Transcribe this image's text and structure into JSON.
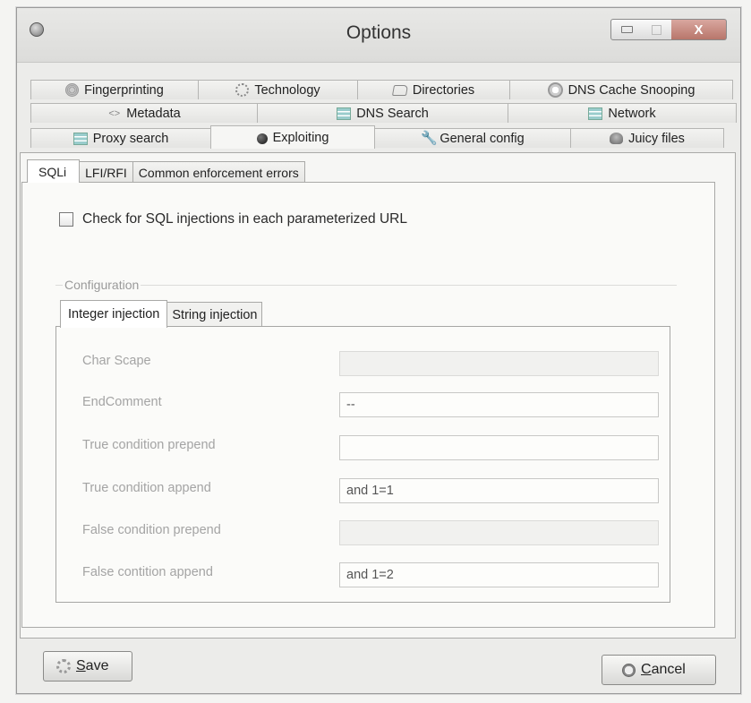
{
  "window": {
    "title": "Options",
    "close_glyph": "X"
  },
  "tabs": {
    "row1": [
      {
        "label": "Fingerprinting",
        "icon": "fingerprint-icon"
      },
      {
        "label": "Technology",
        "icon": "gear-icon"
      },
      {
        "label": "Directories",
        "icon": "folder-icon"
      },
      {
        "label": "DNS Cache Snooping",
        "icon": "globe-icon"
      }
    ],
    "row2": [
      {
        "label": "Metadata",
        "icon": "metadata-icon"
      },
      {
        "label": "DNS Search",
        "icon": "network-tree-icon"
      },
      {
        "label": "Network",
        "icon": "network-icon"
      }
    ],
    "row3": [
      {
        "label": "Proxy search",
        "icon": "network-tree-icon"
      },
      {
        "label": "Exploiting",
        "icon": "bomb-icon",
        "active": true
      },
      {
        "label": "General config",
        "icon": "wrench-icon"
      },
      {
        "label": "Juicy files",
        "icon": "tree-icon"
      }
    ]
  },
  "subtabs": [
    "SQLi",
    "LFI/RFI",
    "Common enforcement errors"
  ],
  "sqli": {
    "checkbox_label": "Check for SQL injections in each parameterized URL",
    "checked": false,
    "group_label": "Configuration",
    "inner_tabs": [
      "Integer injection",
      "String injection"
    ],
    "fields": [
      {
        "label": "Char Scape",
        "value": "",
        "disabled": true
      },
      {
        "label": "EndComment",
        "value": "--",
        "disabled": false
      },
      {
        "label": "True condition prepend",
        "value": "",
        "disabled": false
      },
      {
        "label": "True condition append",
        "value": "and 1=1",
        "disabled": false
      },
      {
        "label": "False condition prepend",
        "value": "",
        "disabled": true
      },
      {
        "label": "False contition append",
        "value": "and 1=2",
        "disabled": false
      }
    ]
  },
  "buttons": {
    "save_hotkey": "S",
    "save_rest": "ave",
    "cancel_hotkey": "C",
    "cancel_rest": "ancel"
  }
}
